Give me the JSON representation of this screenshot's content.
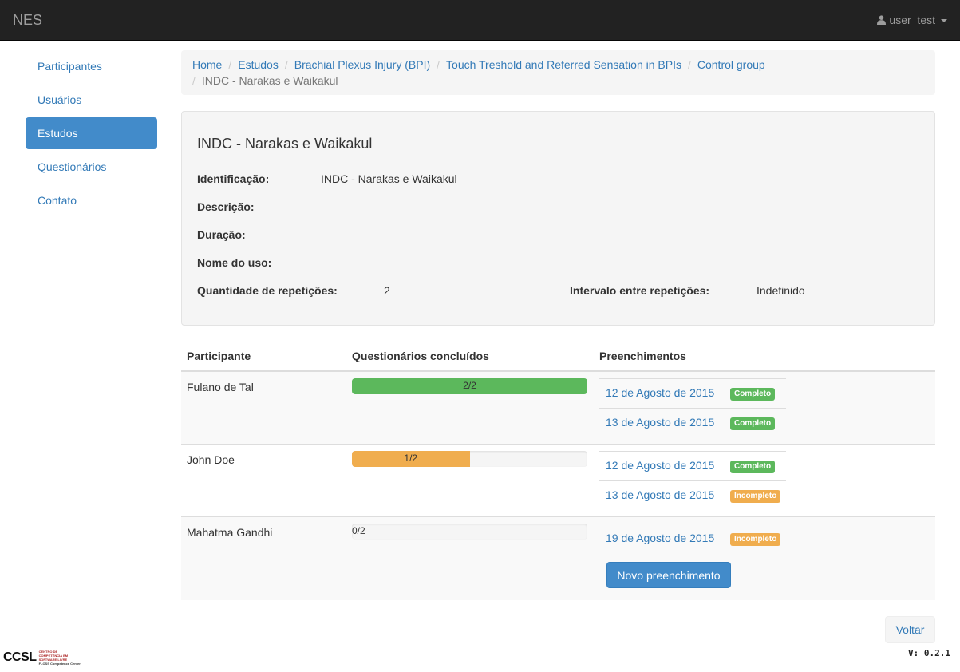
{
  "navbar": {
    "brand": "NES",
    "user": "user_test"
  },
  "sidebar": {
    "items": [
      {
        "label": "Participantes"
      },
      {
        "label": "Usuários"
      },
      {
        "label": "Estudos",
        "active": true
      },
      {
        "label": "Questionários"
      },
      {
        "label": "Contato"
      }
    ]
  },
  "breadcrumb": {
    "links": [
      "Home",
      "Estudos",
      "Brachial Plexus Injury (BPI)",
      "Touch Treshold and Referred Sensation in BPIs",
      "Control group"
    ],
    "current": "INDC - Narakas e Waikakul"
  },
  "details": {
    "title": "INDC - Narakas e Waikakul",
    "identificacao_label": "Identificação:",
    "identificacao_value": "INDC - Narakas e Waikakul",
    "descricao_label": "Descrição:",
    "duracao_label": "Duração:",
    "nome_uso_label": "Nome do uso:",
    "repeticoes_label": "Quantidade de repetições:",
    "repeticoes_value": "2",
    "intervalo_label": "Intervalo entre repetições:",
    "intervalo_value": "Indefinido"
  },
  "table": {
    "headers": [
      "Participante",
      "Questionários concluídos",
      "Preenchimentos"
    ],
    "rows": [
      {
        "participant": "Fulano de Tal",
        "progress_text": "2/2",
        "progress_fraction": 1.0,
        "fills": [
          {
            "date": "12 de Agosto de 2015",
            "status": "Completo"
          },
          {
            "date": "13 de Agosto de 2015",
            "status": "Completo"
          }
        ]
      },
      {
        "participant": "John Doe",
        "progress_text": "1/2",
        "progress_fraction": 0.5,
        "fills": [
          {
            "date": "12 de Agosto de 2015",
            "status": "Completo"
          },
          {
            "date": "13 de Agosto de 2015",
            "status": "Incompleto"
          }
        ]
      },
      {
        "participant": "Mahatma Gandhi",
        "progress_text": "0/2",
        "progress_fraction": 0.0,
        "fills": [
          {
            "date": "19 de Agosto de 2015",
            "status": "Incompleto"
          }
        ],
        "new_button": "Novo preenchimento"
      }
    ]
  },
  "footer": {
    "back_button": "Voltar",
    "version": "V: 0.2.1",
    "logo_text": "CCSL",
    "logo_sub1": "CENTRO DE",
    "logo_sub2": "COMPETÊNCIA EM",
    "logo_sub3": "SOFTWARE LIVRE",
    "logo_sub4": "FLOSS Competence Center"
  },
  "colors": {
    "success": "#5cb85c",
    "warning": "#f0ad4e",
    "primary": "#428bca",
    "link": "#337ab7"
  }
}
